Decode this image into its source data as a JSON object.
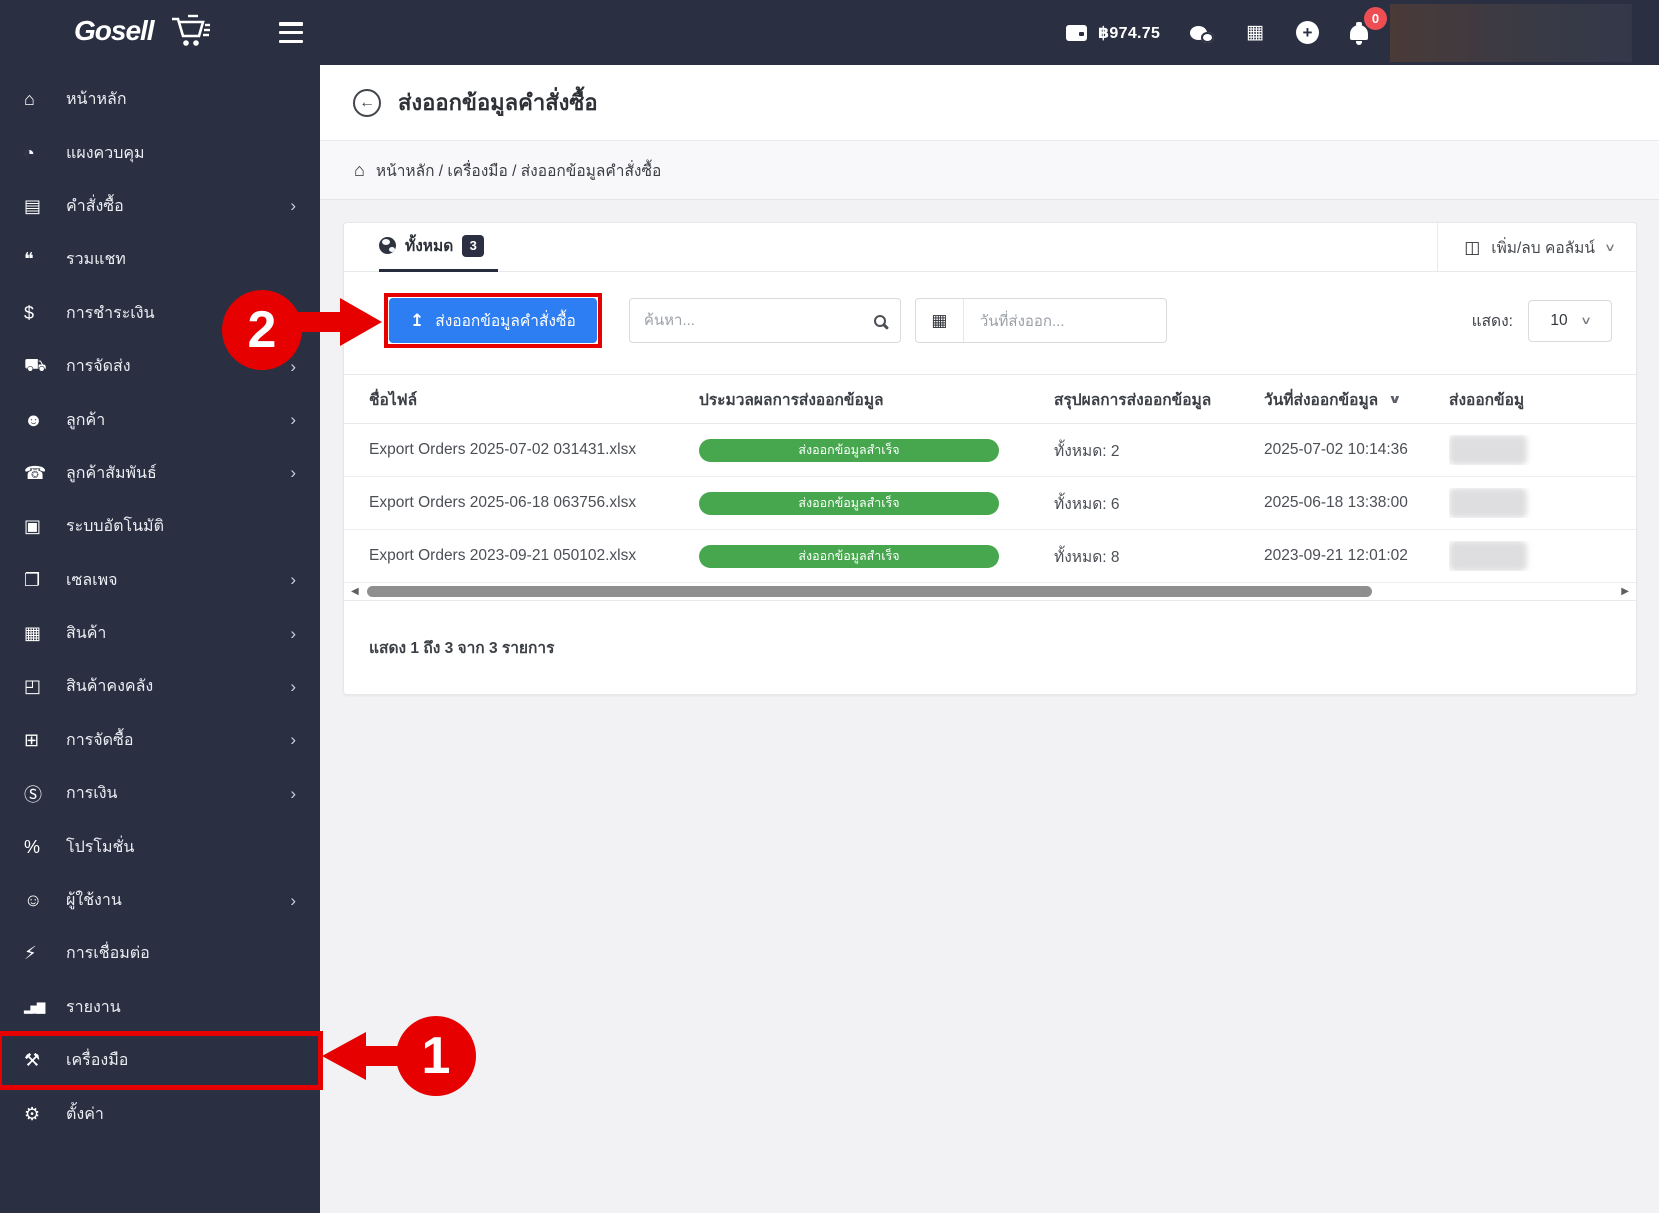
{
  "navbar": {
    "logo": "Gosell",
    "balance": "฿974.75",
    "notification_badge": "0"
  },
  "sidebar": {
    "items": [
      {
        "label": "หน้าหลัก",
        "icon": "home"
      },
      {
        "label": "แผงควบคุม",
        "icon": "dashboard"
      },
      {
        "label": "คำสั่งซื้อ",
        "icon": "orders",
        "chevron": true
      },
      {
        "label": "รวมแชท",
        "icon": "chat"
      },
      {
        "label": "การชำระเงิน",
        "icon": "payment"
      },
      {
        "label": "การจัดส่ง",
        "icon": "shipping",
        "chevron": true
      },
      {
        "label": "ลูกค้า",
        "icon": "customers",
        "chevron": true
      },
      {
        "label": "ลูกค้าสัมพันธ์",
        "icon": "crm",
        "chevron": true
      },
      {
        "label": "ระบบอัตโนมัติ",
        "icon": "automation"
      },
      {
        "label": "เซลเพจ",
        "icon": "salepage",
        "chevron": true
      },
      {
        "label": "สินค้า",
        "icon": "products",
        "chevron": true
      },
      {
        "label": "สินค้าคงคลัง",
        "icon": "inventory",
        "chevron": true
      },
      {
        "label": "การจัดซื้อ",
        "icon": "purchasing",
        "chevron": true
      },
      {
        "label": "การเงิน",
        "icon": "finance",
        "chevron": true
      },
      {
        "label": "โปรโมชั่น",
        "icon": "promotion"
      },
      {
        "label": "ผู้ใช้งาน",
        "icon": "users",
        "chevron": true
      },
      {
        "label": "การเชื่อมต่อ",
        "icon": "integrations"
      },
      {
        "label": "รายงาน",
        "icon": "reports"
      },
      {
        "label": "เครื่องมือ",
        "icon": "tools",
        "highlighted": true
      },
      {
        "label": "ตั้งค่า",
        "icon": "settings"
      }
    ]
  },
  "page": {
    "title": "ส่งออกข้อมูลคำสั่งซื้อ",
    "breadcrumb": "หน้าหลัก / เครื่องมือ / ส่งออกข้อมูลคำสั่งซื้อ"
  },
  "card": {
    "tab": {
      "label": "ทั้งหมด",
      "badge": "3"
    },
    "columns_button": "เพิ่ม/ลบ คอลัมน์",
    "export_button": "ส่งออกข้อมูลคำสั่งซื้อ",
    "search_placeholder": "ค้นหา...",
    "date_placeholder": "วันที่ส่งออก...",
    "show_label": "แสดง:",
    "show_value": "10",
    "table": {
      "headers": [
        {
          "label": "ชื่อไฟล์"
        },
        {
          "label": "ประมวลผลการส่งออกข้อมูล"
        },
        {
          "label": "สรุปผลการส่งออกข้อมูล"
        },
        {
          "label": "วันที่ส่งออกข้อมูล",
          "sortable": true
        },
        {
          "label": "ส่งออกข้อมู",
          "clipped": true
        }
      ],
      "rows": [
        {
          "file": "Export Orders 2025-07-02 031431.xlsx",
          "status": "ส่งออกข้อมูลสำเร็จ",
          "summary": "ทั้งหมด: 2",
          "date": "2025-07-02 10:14:36"
        },
        {
          "file": "Export Orders 2025-06-18 063756.xlsx",
          "status": "ส่งออกข้อมูลสำเร็จ",
          "summary": "ทั้งหมด: 6",
          "date": "2025-06-18 13:38:00"
        },
        {
          "file": "Export Orders 2023-09-21 050102.xlsx",
          "status": "ส่งออกข้อมูลสำเร็จ",
          "summary": "ทั้งหมด: 8",
          "date": "2023-09-21 12:01:02"
        }
      ]
    },
    "footer": "แสดง 1 ถึง 3 จาก 3 รายการ"
  },
  "annotations": {
    "step1": "1",
    "step2": "2"
  },
  "icon_glyphs": {
    "home": "⌂",
    "dashboard": "◔",
    "orders": "▤",
    "chat": "❝",
    "payment": "$",
    "shipping": "⛟",
    "customers": "☻",
    "crm": "☎",
    "automation": "▣",
    "salepage": "❐",
    "products": "▦",
    "inventory": "◰",
    "purchasing": "⊞",
    "finance": "Ⓢ",
    "promotion": "%",
    "users": "☺",
    "integrations": "⚡",
    "reports": "▂▅▇",
    "tools": "⚒",
    "settings": "⚙"
  },
  "colors": {
    "accent_blue": "#2c7ef2",
    "success_green": "#47a74e",
    "annotation_red": "#e60000",
    "sidebar_bg": "#2a3042"
  }
}
